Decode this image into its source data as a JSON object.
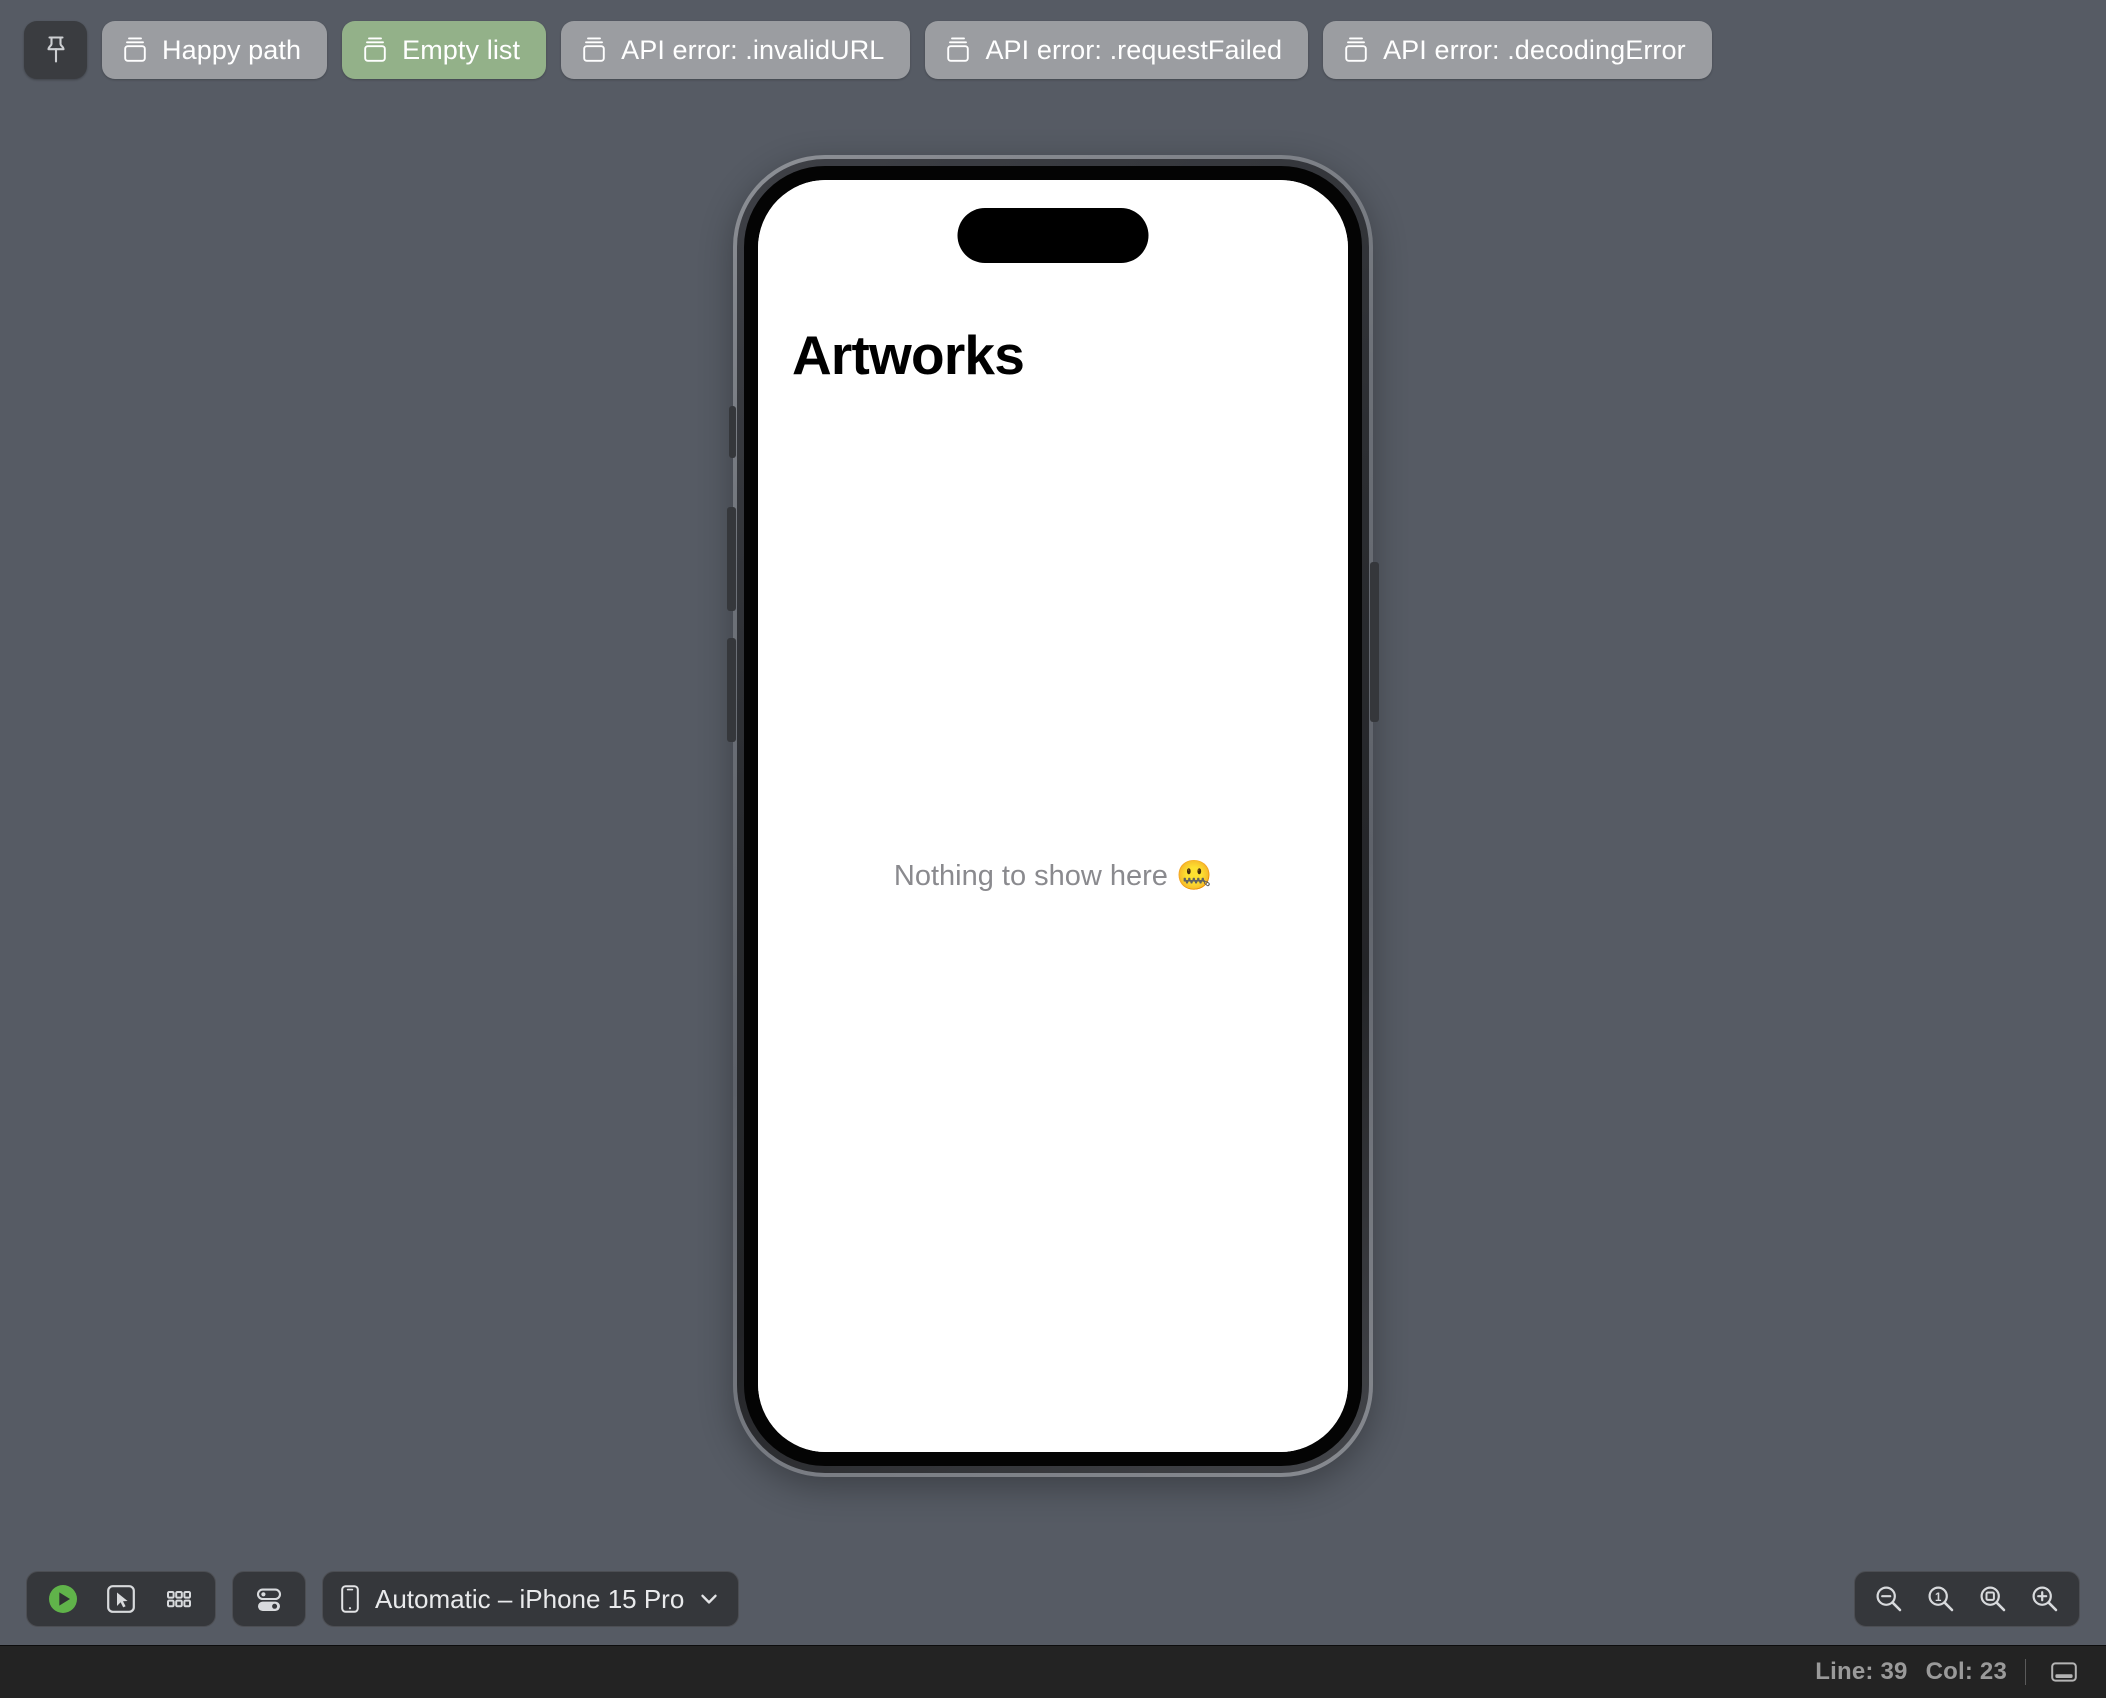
{
  "variant_bar": {
    "pin_button": {
      "icon": "pushpin-icon",
      "tooltip": "Pin preview"
    },
    "variants": [
      {
        "label": "Happy path",
        "icon": "preview-variant-icon",
        "selected": false
      },
      {
        "label": "Empty list",
        "icon": "preview-variant-icon",
        "selected": true
      },
      {
        "label": "API error: .invalidURL",
        "icon": "preview-variant-icon",
        "selected": false
      },
      {
        "label": "API error: .requestFailed",
        "icon": "preview-variant-icon",
        "selected": false
      },
      {
        "label": "API error: .decodingError",
        "icon": "preview-variant-icon",
        "selected": false
      }
    ],
    "selected_color": "#93b189",
    "unselected_color": "#9b9da1"
  },
  "preview": {
    "device_name": "iPhone 15 Pro",
    "screen": {
      "nav_title": "Artworks",
      "empty_state_text": "Nothing to show here 🤐",
      "background_color": "#ffffff",
      "title_color": "#000000",
      "empty_text_color": "#8a8a8e"
    },
    "hardware": {
      "dynamic_island": true,
      "side_buttons": [
        "silent-switch",
        "volume-up-button",
        "volume-down-button",
        "power-button"
      ]
    }
  },
  "bottom_toolbar": {
    "mode_buttons": [
      {
        "name": "live-preview-button",
        "icon": "play-circle-icon",
        "active": true
      },
      {
        "name": "selectable-mode-button",
        "icon": "cursor-box-icon",
        "active": false
      },
      {
        "name": "variants-mode-button",
        "icon": "grid-dots-icon",
        "active": false
      }
    ],
    "settings_button": {
      "name": "preview-settings-button",
      "icon": "switches-icon"
    },
    "device_picker": {
      "icon": "iphone-icon",
      "label": "Automatic – iPhone 15 Pro",
      "chevron": "chevron-down-icon"
    },
    "zoom_controls": [
      {
        "name": "zoom-out-button",
        "icon": "magnifier-minus-icon"
      },
      {
        "name": "zoom-actual-size-button",
        "icon": "magnifier-one-icon"
      },
      {
        "name": "zoom-to-fit-button",
        "icon": "magnifier-fit-icon"
      },
      {
        "name": "zoom-in-button",
        "icon": "magnifier-plus-icon"
      }
    ]
  },
  "status_bar": {
    "line_label": "Line: 39",
    "col_label": "Col: 23",
    "panel_toggle_icon": "bottom-panel-icon"
  },
  "colors": {
    "canvas_background": "#565b64",
    "toolbar_control": "#35373b",
    "status_bar_background": "#232323",
    "accent_green": "#60b34a"
  }
}
